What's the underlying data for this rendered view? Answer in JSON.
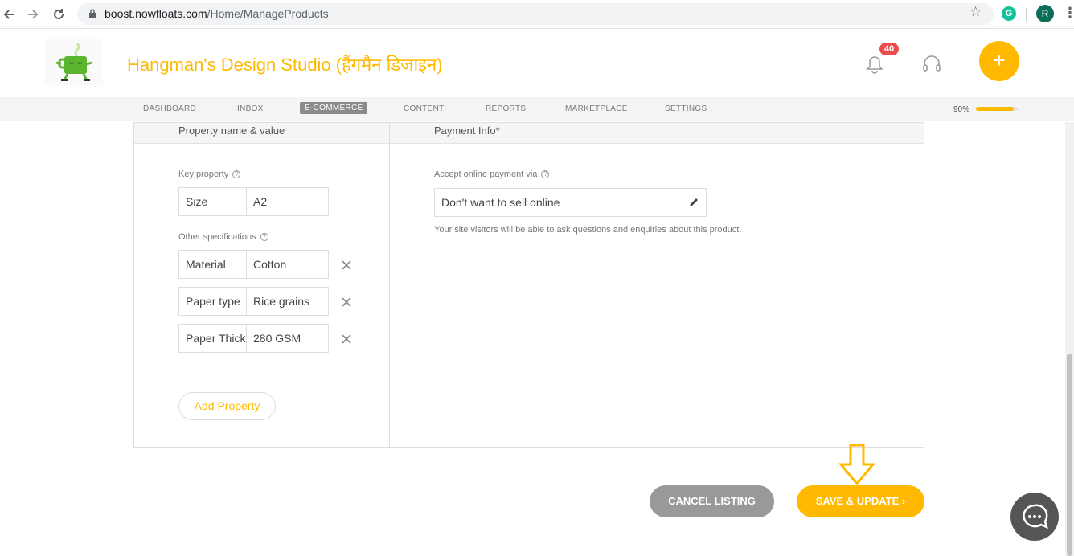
{
  "browser": {
    "url_host": "boost.nowfloats.com",
    "url_path": "/Home/ManageProducts",
    "extension_letter": "G",
    "profile_initial": "R"
  },
  "header": {
    "studio_name": "Hangman's Design Studio (हैंगमैन डिजाइन)",
    "notification_count": "40"
  },
  "tabs": [
    {
      "label": "DASHBOARD"
    },
    {
      "label": "INBOX"
    },
    {
      "label": "E-COMMERCE",
      "active": true
    },
    {
      "label": "CONTENT"
    },
    {
      "label": "REPORTS"
    },
    {
      "label": "MARKETPLACE"
    },
    {
      "label": "SETTINGS"
    }
  ],
  "profile_progress": {
    "label": "90%",
    "value": 0.9
  },
  "left_panel": {
    "title": "Property name & value",
    "key_property_label": "Key property",
    "key_property": {
      "name": "Size",
      "value": "A2"
    },
    "other_specs_label": "Other specifications",
    "other_specs": [
      {
        "name": "Material",
        "value": "Cotton"
      },
      {
        "name": "Paper type",
        "value": "Rice grains"
      },
      {
        "name": "Paper Thickness",
        "value": "280 GSM"
      }
    ],
    "add_property_label": "Add Property"
  },
  "right_panel": {
    "title": "Payment Info*",
    "accept_label": "Accept online payment via",
    "payment_value": "Don't want to sell online",
    "hint": "Your site visitors will be able to ask questions and enquiries about this product."
  },
  "actions": {
    "cancel_label": "CANCEL LISTING",
    "save_label": "SAVE & UPDATE ›"
  },
  "colors": {
    "accent": "#ffb900",
    "cancel": "#999999",
    "badge": "#ee4b4b"
  }
}
